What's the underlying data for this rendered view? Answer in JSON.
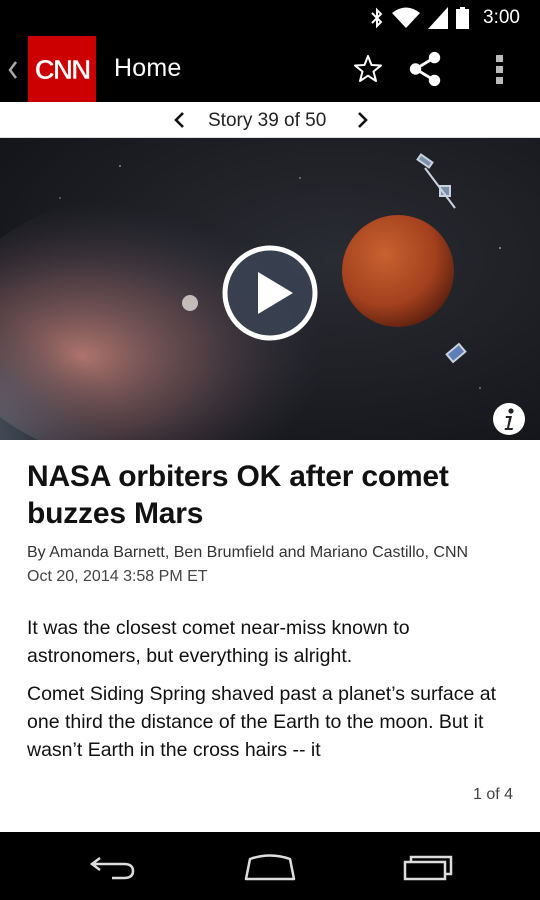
{
  "status_bar": {
    "time": "3:00",
    "icons": [
      "bluetooth-icon",
      "wifi-icon",
      "signal-icon",
      "battery-icon"
    ]
  },
  "action_bar": {
    "back_icon": "chevron-left-icon",
    "logo_text": "CNN",
    "title": "Home",
    "actions": [
      "star-icon",
      "share-icon",
      "overflow-menu-icon"
    ],
    "brand_color": "#cc0000"
  },
  "story_nav": {
    "label": "Story 39 of 50",
    "prev_icon": "chevron-left-icon",
    "next_icon": "chevron-right-icon"
  },
  "hero": {
    "play_icon": "play-icon",
    "info_icon": "info-icon"
  },
  "article": {
    "headline": "NASA orbiters OK after comet buzzes Mars",
    "byline": "By Amanda Barnett, Ben Brumfield and Mariano Castillo, CNN",
    "date": "Oct 20, 2014 3:58 PM ET",
    "paragraphs": [
      "It was the closest comet near-miss known to astronomers, but everything is alright.",
      "Comet Siding Spring shaved past a planet’s surface at one third the distance of the Earth to the moon. But it wasn’t Earth in the cross hairs -- it"
    ],
    "page_indicator": "1 of 4"
  },
  "nav_bar": {
    "buttons": [
      "back-icon",
      "home-icon",
      "recents-icon"
    ]
  }
}
